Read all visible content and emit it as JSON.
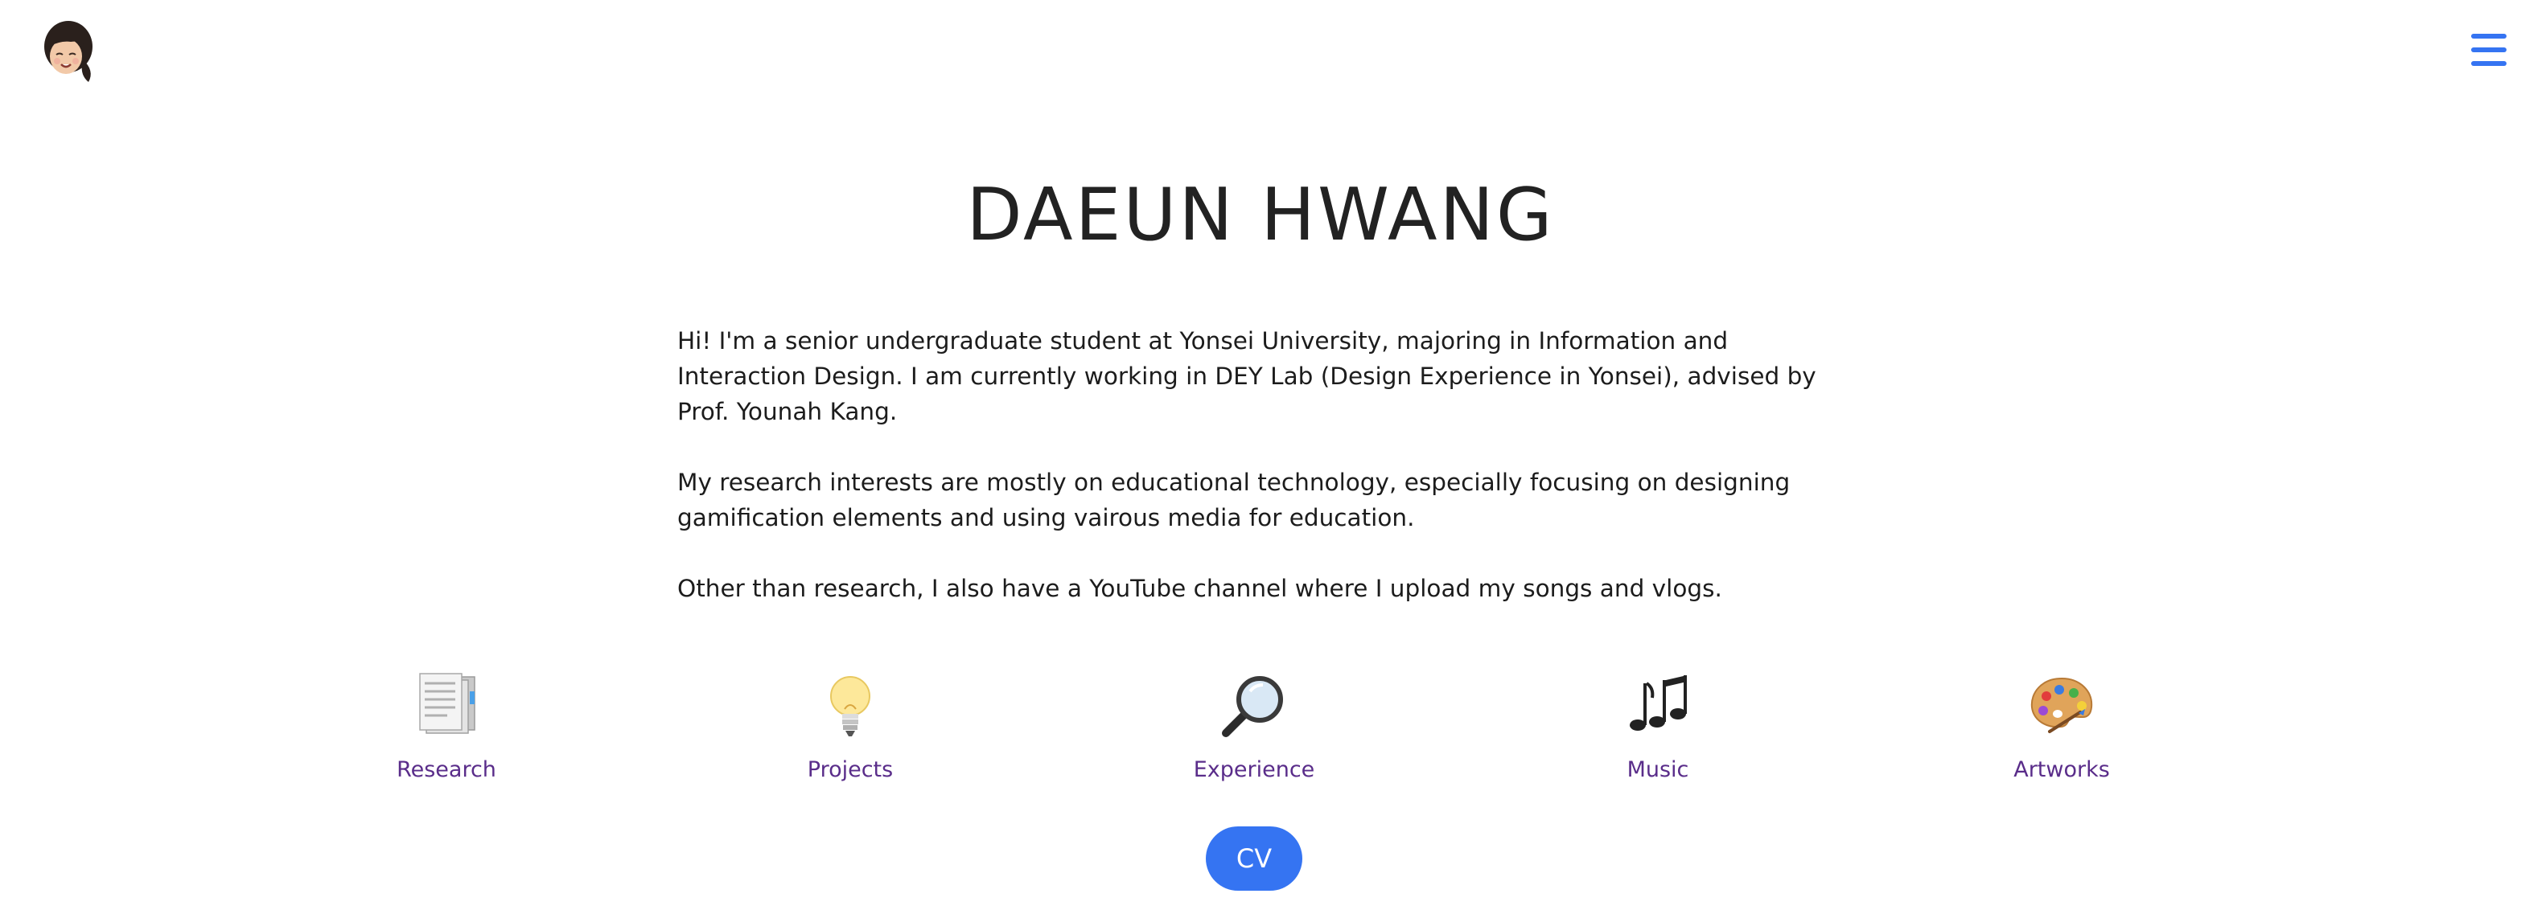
{
  "header": {
    "avatar_alt": "memoji avatar",
    "menu_icon": "hamburger-menu-icon"
  },
  "title": "DAEUN HWANG",
  "intro": {
    "p1": "Hi! I'm a senior undergraduate student at Yonsei University, majoring in Information and Interaction Design. I am currently working in DEY Lab (Design Experience in Yonsei), advised by Prof. Younah Kang.",
    "p2": "My research interests are mostly on educational technology, especially focusing on designing gamification elements and using vairous media for education.",
    "p3": "Other than research, I also have a YouTube channel where I upload my songs and vlogs."
  },
  "nav": {
    "items": [
      {
        "label": "Research",
        "icon": "document-icon"
      },
      {
        "label": "Projects",
        "icon": "lightbulb-icon"
      },
      {
        "label": "Experience",
        "icon": "magnifier-icon"
      },
      {
        "label": "Music",
        "icon": "music-notes-icon"
      },
      {
        "label": "Artworks",
        "icon": "palette-icon"
      }
    ]
  },
  "cv_button": {
    "label": "CV"
  },
  "colors": {
    "accent": "#3574f2",
    "link": "#5a2d8a",
    "text": "#1c1c1c"
  }
}
